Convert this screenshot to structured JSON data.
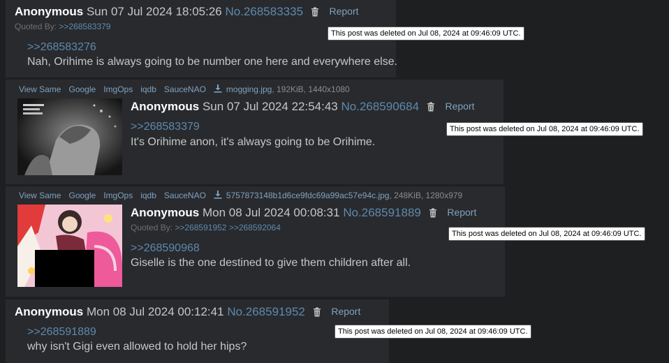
{
  "posts": [
    {
      "name": "Anonymous",
      "date": "Sun 07 Jul 2024 18:05:26",
      "number": "No.268583335",
      "report": "Report",
      "quoted_by_label": "Quoted By:",
      "quoted_by": [
        ">>268583379"
      ],
      "quote": ">>268583276",
      "message": "Nah, Orihime is always going to be number one here and everywhere else.",
      "deleted_notice": "This post was deleted on Jul 08, 2024 at 09:46:09 UTC."
    },
    {
      "file_links": [
        "View Same",
        "Google",
        "ImgOps",
        "iqdb",
        "SauceNAO"
      ],
      "file_name": "mogging.jpg",
      "file_meta": ", 192KiB, 1440x1080",
      "name": "Anonymous",
      "date": "Sun 07 Jul 2024 22:54:43",
      "number": "No.268590684",
      "report": "Report",
      "quote": ">>268583379",
      "message": "It's Orihime anon, it's always going to be Orihime.",
      "deleted_notice": "This post was deleted on Jul 08, 2024 at 09:46:09 UTC."
    },
    {
      "file_links": [
        "View Same",
        "Google",
        "ImgOps",
        "iqdb",
        "SauceNAO"
      ],
      "file_name": "5757873148b1d6ce9fdc69a99ac57e94c.jpg",
      "file_meta": ", 248KiB, 1280x979",
      "name": "Anonymous",
      "date": "Mon 08 Jul 2024 00:08:31",
      "number": "No.268591889",
      "report": "Report",
      "quoted_by_label": "Quoted By:",
      "quoted_by": [
        ">>268591952",
        ">>268592064"
      ],
      "quote": ">>268590968",
      "message": "Giselle is the one destined to give them children after all.",
      "deleted_notice": "This post was deleted on Jul 08, 2024 at 09:46:09 UTC."
    },
    {
      "name": "Anonymous",
      "date": "Mon 08 Jul 2024 00:12:41",
      "number": "No.268591952",
      "report": "Report",
      "quote": ">>268591889",
      "message": "why isn't Gigi even allowed to hold her hips?",
      "deleted_notice": "This post was deleted on Jul 08, 2024 at 09:46:09 UTC."
    }
  ],
  "icons": {
    "trash": "trash-icon",
    "download": "download-icon"
  },
  "colors": {
    "background": "#1d1f21",
    "post": "#282a2e",
    "link": "#5f89ac",
    "name": "#ffffff"
  }
}
